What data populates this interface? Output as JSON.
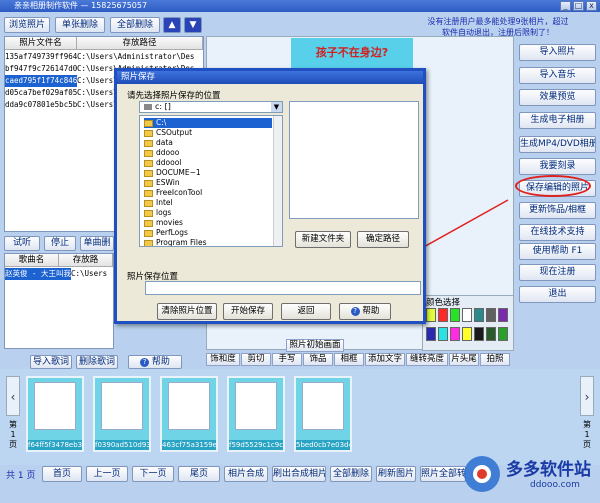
{
  "window": {
    "title": "亲亲相册制作软件 — 15825675057"
  },
  "toolbar": {
    "browse": "浏览照片",
    "delete_one": "单张删除",
    "delete_all": "全部删除",
    "up": "▲",
    "down": "▼"
  },
  "notice": {
    "line1": "没有注册用户最多能处理9张相片，超过",
    "line2": "软件自动退出，注册后限制了！"
  },
  "photo_grid": {
    "col1": "照片文件名",
    "col2": "存放路径",
    "rows": [
      {
        "name": "135af749739ff964",
        "path": "C:\\Users\\Administrator\\Des"
      },
      {
        "name": "bf947f9c726147d0",
        "path": "C:\\Users\\Administrator\\Des"
      },
      {
        "name": "caed795f1f74c846",
        "path": "C:\\Users\\Administrator\\Des"
      },
      {
        "name": "d05ca7bef029af05",
        "path": "C:\\Users\\Administrator\\Des"
      },
      {
        "name": "dda9c07801e5bc5b",
        "path": "C:\\Users\\Administrator\\Des"
      }
    ]
  },
  "music": {
    "listen": "试听",
    "stop": "停止",
    "delete_one": "单曲删",
    "col1": "歌曲名",
    "col2": "存放路",
    "row_name": "赵英俊 - 大王叫我",
    "row_path": "C:\\Users"
  },
  "preview_banner": "孩子不在身边?",
  "right_buttons": [
    "导入照片",
    "导入音乐",
    "效果预览",
    "生成电子相册",
    "生成MP4/DVD相册",
    "我要刻录",
    "保存编辑的照片",
    "更新饰品/相框",
    "在线技术支持",
    "使用帮助  F1",
    "现在注册",
    "退出"
  ],
  "colors": {
    "title": "颜色选择",
    "swatches": [
      "#e2ff3c",
      "#ff2a2a",
      "#28e228",
      "#ffffff",
      "#2a8a8a",
      "#606060",
      "#7a2aaa",
      "#2a2ab0",
      "#2ae2e2",
      "#ff2ae2",
      "#ffff2a",
      "#1a1a1a",
      "#2a5a2a",
      "#2aa02a"
    ]
  },
  "lyrics": {
    "import": "导入歌词",
    "delete": "删除歌词",
    "help": "帮助"
  },
  "tabs": [
    "照片初始画面",
    "饰和度",
    "剪切",
    "手写",
    "饰品",
    "相框",
    "添加文字",
    "缝转亮度",
    "片头尾",
    "拍照"
  ],
  "thumbnails": [
    {
      "label": "f64ff5f3478eb32e5"
    },
    {
      "label": "f0390ad510d93bfc"
    },
    {
      "label": "463cf75a3159ef54"
    },
    {
      "label": "f59d5529c1c9c31"
    },
    {
      "label": "5bed0cb7e03d4bc"
    }
  ],
  "page_side": {
    "left_a": "第",
    "left_b": "1",
    "left_c": "页",
    "right_a": "第",
    "right_b": "1",
    "right_c": "页"
  },
  "bottom": {
    "total": "共 1 页",
    "first": "首页",
    "prev": "上一页",
    "next": "下一页",
    "last": "尾页",
    "compose": "相片合成",
    "refresh_compose": "刷出合成相片",
    "delete_all": "全部删除",
    "refresh_pics": "刷新图片",
    "watermark_btn": "照片全部转换"
  },
  "dialog": {
    "title": "照片保存",
    "prompt": "请先选择照片保存的位置",
    "drive": "c: []",
    "folders": [
      "C:\\",
      "CSOutput",
      "data",
      "ddooo",
      "ddoool",
      "DOCUME~1",
      "ESWin",
      "FreeIconTool",
      "Intel",
      "logs",
      "movies",
      "PerfLogs",
      "Program Files"
    ],
    "new_folder": "新建文件夹",
    "confirm_path": "确定路径",
    "save_location": "照片保存位置",
    "clear": "清除照片位置",
    "start_save": "开始保存",
    "back": "返回",
    "help": "帮助"
  },
  "watermark": {
    "name": "多多软件站",
    "url": "ddooo.com"
  }
}
